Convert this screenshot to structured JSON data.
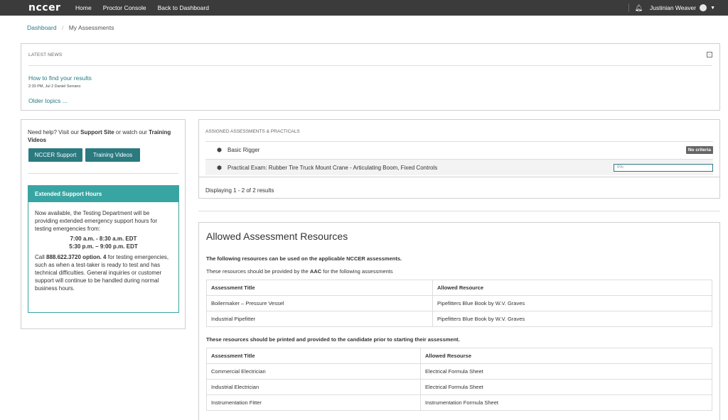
{
  "nav": {
    "logo": "nccer",
    "links": [
      "Home",
      "Proctor Console",
      "Back to Dashboard"
    ],
    "user": "Justinian Weaver"
  },
  "breadcrumb": {
    "root": "Dashboard",
    "sep": "/",
    "current": "My Assessments"
  },
  "news": {
    "header": "LATEST NEWS",
    "toggle": "-",
    "item_title": "How to find your results",
    "item_meta": "2:33 PM, Jul 2  Daniel Serrano",
    "older": "Older topics ..."
  },
  "help": {
    "text_a": "Need help? Visit our ",
    "support_site": "Support Site",
    "text_b": " or watch our ",
    "training_videos": "Training Videos",
    "btn_support": "NCCER Support",
    "btn_videos": "Training Videos",
    "ext_title": "Extended Support Hours",
    "ext_p1": "Now available, the Testing Department will be providing extended emergency support hours for testing emergencies from:",
    "time1": "7:00 a.m. - 8:30 a.m. EDT",
    "time2": "5:30 p.m. – 9:00 p.m. EDT",
    "ext_p2a": "Call ",
    "phone": "888.622.3720 option. 4",
    "ext_p2b": " for testing emergencies, such as when a test-taker is ready to test and has technical difficulties. General inquiries or customer support will continue to be handled during normal business hours."
  },
  "assigned": {
    "header": "ASSIGNED ASSESSMENTS & PRACTICALS",
    "rows": [
      {
        "title": "Basic Rigger",
        "status": "No criteria"
      },
      {
        "title": "Practical Exam: Rubber Tire Truck Mount Crane - Articulating Boom, Fixed Controls",
        "progress": "0%"
      }
    ],
    "footer": "Displaying 1 - 2 of 2 results"
  },
  "resources": {
    "title": "Allowed Assessment Resources",
    "sub1": "The following resources can be used on the applicable NCCER assessments.",
    "note_a": "These resources should be provided by the ",
    "note_aac": "AAC",
    "note_b": " for the following assessments",
    "table1": {
      "headers": [
        "Assessment Title",
        "Allowed Resource"
      ],
      "rows": [
        [
          "Boilermaker – Pressure Vessel",
          "Pipefitters Blue Book by W.V. Graves"
        ],
        [
          "Industrial Pipefitter",
          "Pipefitters Blue Book by W.V. Graves"
        ]
      ]
    },
    "sub2": "These resources should be printed and provided to the candidate prior to starting their assessment.",
    "table2": {
      "headers": [
        "Assessment Title",
        "Allowed Resourse"
      ],
      "rows": [
        [
          "Commercial Electrician",
          "Electrical Formula Sheet"
        ],
        [
          "Industrial Electrician",
          "Electrical Formula Sheet"
        ],
        [
          "Instrumentation Fitter",
          "Instrumentation Formula Sheet"
        ]
      ]
    }
  }
}
